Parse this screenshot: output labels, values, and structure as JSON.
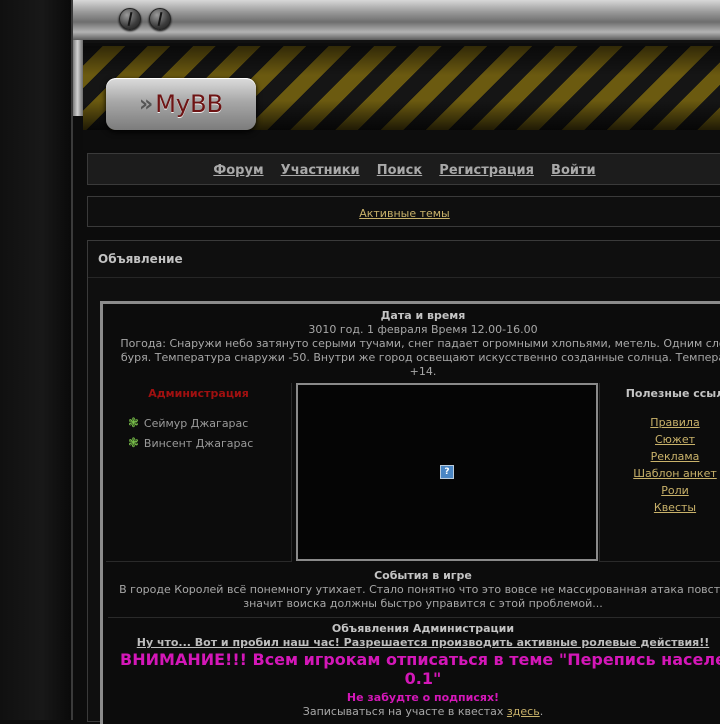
{
  "header": {
    "logo_text": "MyBB",
    "logo_chevrons": "»"
  },
  "nav": {
    "items": [
      "Форум",
      "Участники",
      "Поиск",
      "Регистрация",
      "Войти"
    ]
  },
  "active_topics": "Активные темы",
  "announcement": {
    "title": "Объявление",
    "datetime": {
      "title": "Дата и время",
      "line1": "3010 год. 1 февраля Время 12.00-16.00",
      "line2": "Погода: Снаружи небо затянуто серыми тучами, снег падает огромными хлопьями, метель. Одним сло",
      "line3": "буря. Температура снаружи -50. Внутри же город освещают искусственно созданные солнца. Темпера",
      "line4": "+14."
    },
    "admin": {
      "title": "Администрация",
      "members": [
        "Сеймур Джагарас",
        "Винсент Джагарас"
      ],
      "leaf_icon": "❃"
    },
    "broken_image_icon": "?",
    "links": {
      "title": "Полезные ссыл",
      "items": [
        "Правила",
        "Сюжет",
        "Реклама",
        "Шаблон анкет",
        "Роли",
        "Квесты"
      ]
    },
    "events": {
      "title": "События в игре",
      "line1": "В городе Королей всё понемногу утихает. Стало понятно что это вовсе не массированная атака повста",
      "line2": "значит воиска должны быстро управится с этой проблемой..."
    },
    "admin_news": {
      "title": "Объявления Администрации",
      "link_text": "Ну что... Вот и пробил наш час! Разрешается производить активные ролевые действия!!",
      "warning_line1": "ВНИМАНИЕ!!! Всем игрокам отписаться в теме \"Перепись населе",
      "warning_line2": "0.1\"",
      "reminder": "Не забудте о подписях!",
      "quests_prefix": "Записываться на участе в квестах ",
      "quests_link": "здесь",
      "quests_suffix": "."
    }
  },
  "colors": {
    "admin_red": "#a01010",
    "link_gold": "#c9b26a",
    "warning_pink": "#d417b8",
    "hazard_yellow": "#6b5a10"
  }
}
